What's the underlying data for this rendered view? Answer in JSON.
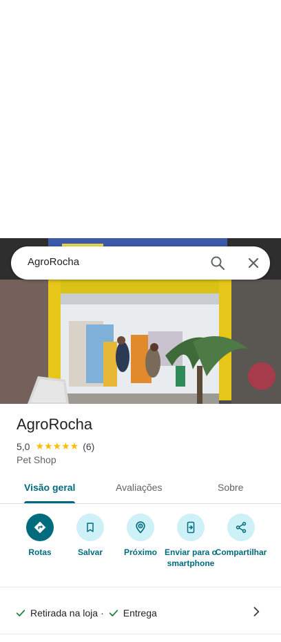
{
  "search": {
    "query": "AgroRocha"
  },
  "place": {
    "name": "AgroRocha",
    "rating_value": "5,0",
    "rating_stars": "★★★★★",
    "review_count": "(6)",
    "category": "Pet Shop"
  },
  "tabs": [
    {
      "label": "Visão geral",
      "active": true
    },
    {
      "label": "Avaliações",
      "active": false
    },
    {
      "label": "Sobre",
      "active": false
    }
  ],
  "actions": [
    {
      "label": "Rotas",
      "icon": "directions-icon"
    },
    {
      "label": "Salvar",
      "icon": "bookmark-icon"
    },
    {
      "label": "Próximo",
      "icon": "nearby-icon"
    },
    {
      "label": "Enviar para o smartphone",
      "icon": "send-to-phone-icon"
    },
    {
      "label": "Compartilhar",
      "icon": "share-icon"
    }
  ],
  "features": {
    "item1": "Retirada na loja",
    "separator": "·",
    "item2": "Entrega"
  },
  "colors": {
    "accent": "#006b7d",
    "accent_light": "#cdf1f6",
    "star": "#fbbc04",
    "check": "#188038"
  }
}
